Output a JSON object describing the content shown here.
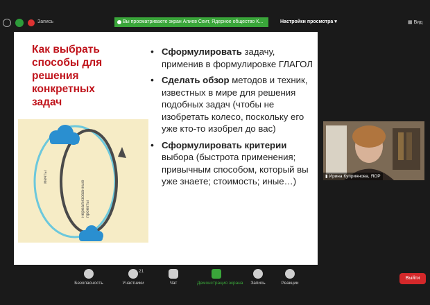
{
  "topbar": {
    "rec_label": "Запись",
    "share_banner": "Вы просматриваете экран Алиев Сеит, Ядерное общество К...",
    "view_options": "Настройки просмотра",
    "view_button": "Вид"
  },
  "slide": {
    "title": "Как выбрать способы для решения конкретных задач",
    "diagram": {
      "label_outer": "мечты",
      "label_inner": "нереализованные проекты"
    },
    "bullets": [
      {
        "bold": "Сформулировать",
        "text": " задачу, применив в формулировке ГЛАГОЛ"
      },
      {
        "bold": "Сделать обзор",
        "text": " методов и техник, известных в мире для решения подобных задач (чтобы не изобретать колесо, поскольку его уже кто-то изобрел до вас)"
      },
      {
        "bold": "Сформулировать критерии",
        "text": " выбора (быстрота применения; привычным способом, который вы уже знаете; стоимость; иные…)"
      }
    ]
  },
  "participant": {
    "name": "Ирина Куприянова, ЯОР"
  },
  "toolbar": {
    "security": "Безопасность",
    "participants": "Участники",
    "participants_count": "21",
    "chat": "Чат",
    "share": "Демонстрация экрана",
    "record": "Запись",
    "reactions": "Реакции",
    "leave": "Выйти"
  },
  "colors": {
    "title_red": "#c0141c",
    "share_green": "#3aa63a",
    "leave_red": "#d4282a",
    "diagram_bg": "#f6ecc6"
  }
}
